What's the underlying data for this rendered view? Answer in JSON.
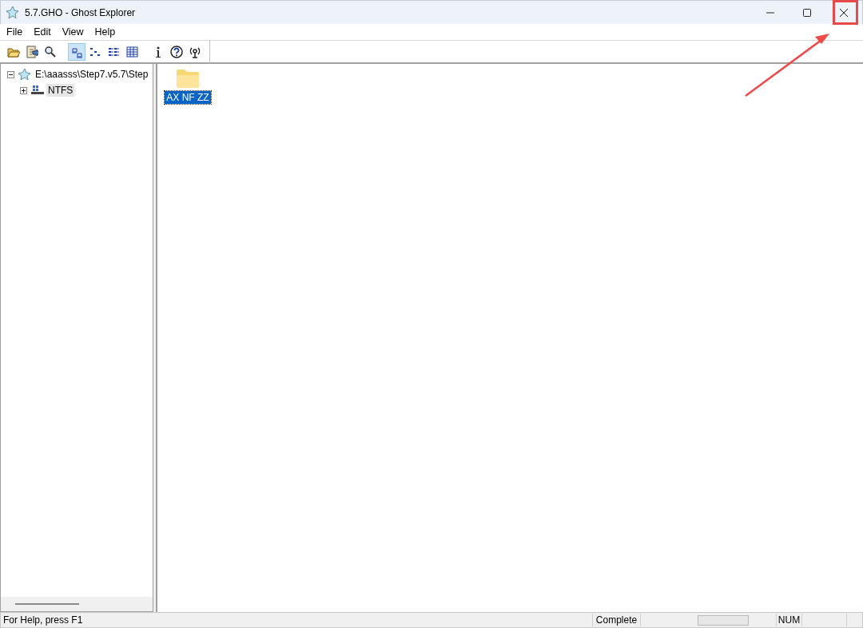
{
  "window": {
    "title": "5.7.GHO - Ghost Explorer"
  },
  "menu": [
    {
      "label": "File"
    },
    {
      "label": "Edit"
    },
    {
      "label": "View"
    },
    {
      "label": "Help"
    }
  ],
  "toolbar": {
    "tools": [
      {
        "kind": "open"
      },
      {
        "kind": "extract"
      },
      {
        "kind": "find"
      }
    ],
    "view_modes": [
      {
        "kind": "large",
        "selected": true
      },
      {
        "kind": "small",
        "selected": false
      },
      {
        "kind": "list",
        "selected": false
      },
      {
        "kind": "details",
        "selected": false
      }
    ],
    "extra": [
      {
        "kind": "info"
      },
      {
        "kind": "help"
      },
      {
        "kind": "properties"
      }
    ]
  },
  "tree": [
    {
      "label": "E:\\aaasss\\Step7.v5.7\\Step",
      "kind": "image",
      "expanded": true,
      "selected": false,
      "children": [
        {
          "label": "NTFS",
          "kind": "partition",
          "expanded": false,
          "selected": true
        }
      ]
    }
  ],
  "files": [
    {
      "name": "AX NF ZZ",
      "selected": true
    }
  ],
  "status_bar": {
    "help": "For Help, press F1",
    "state": "Complete",
    "progress": {
      "level": 0
    },
    "num": "NUM"
  }
}
